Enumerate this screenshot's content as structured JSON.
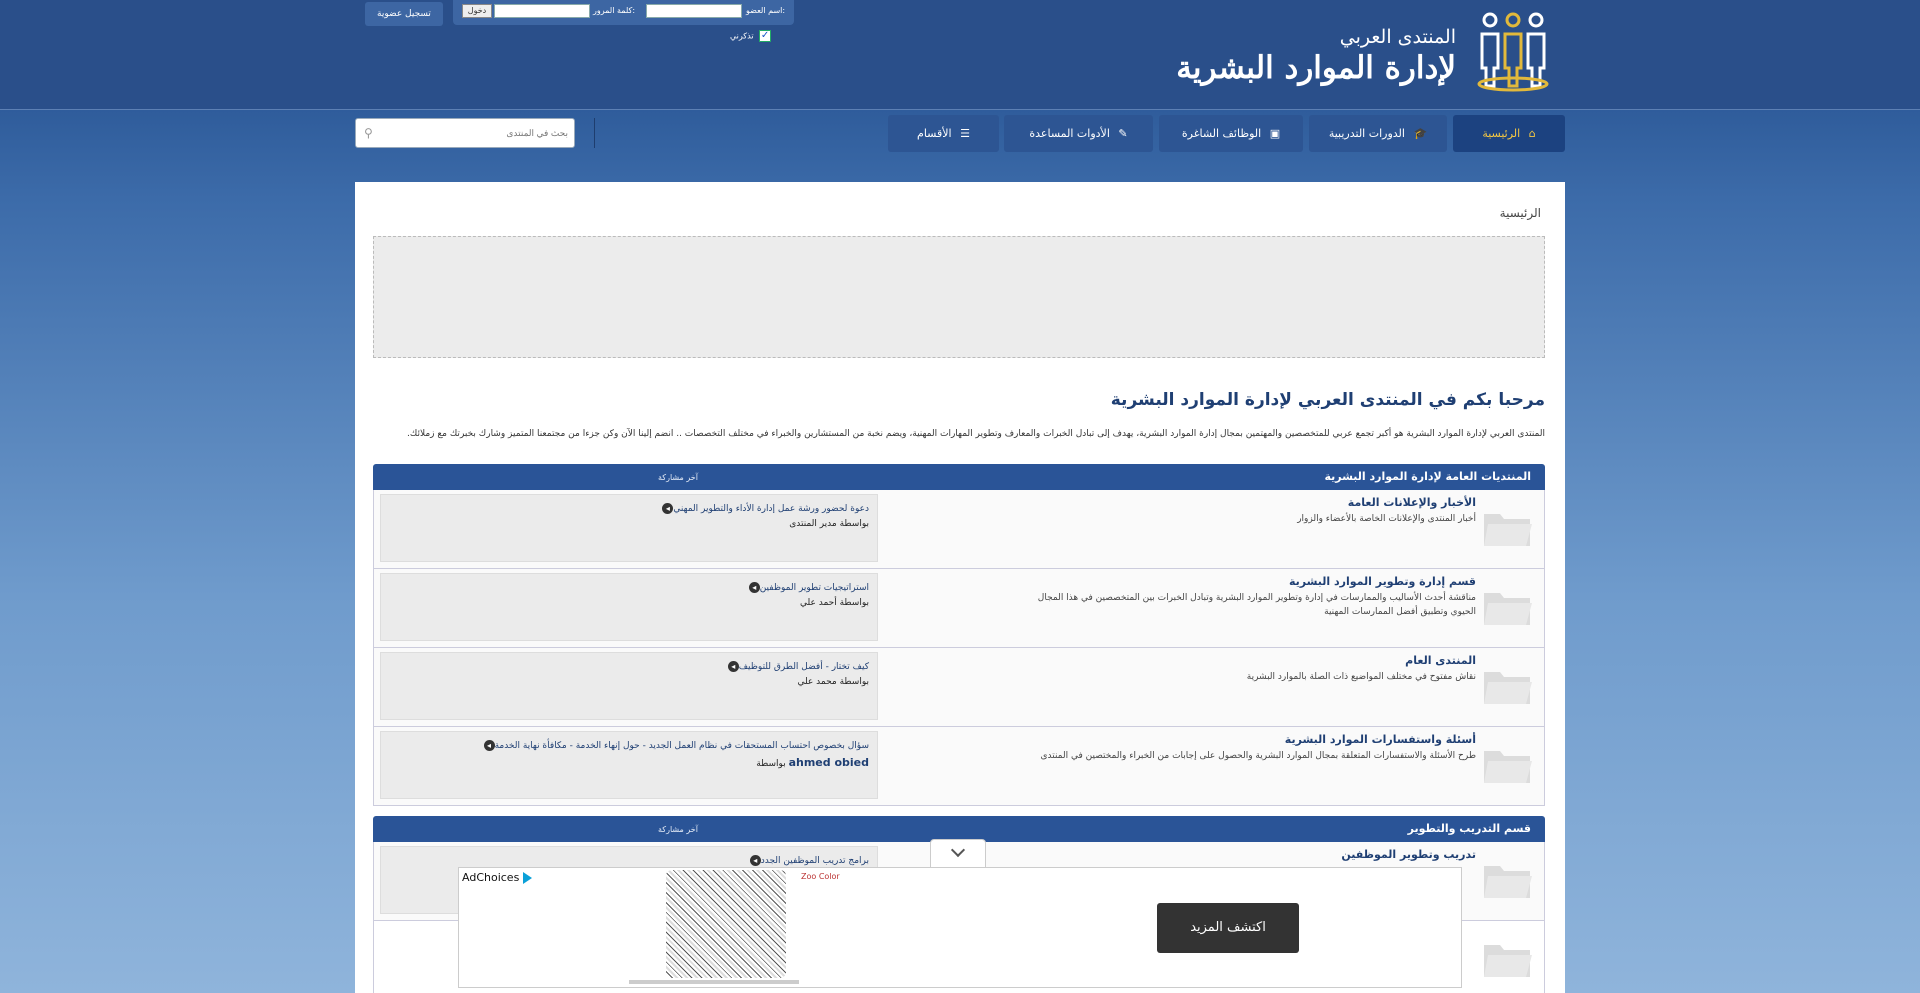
{
  "header": {
    "logo_small": "المنتدى العربي",
    "logo_big": "لإدارة الموارد البشرية",
    "login": {
      "username_label": "اسم العضو:",
      "password_label": "كلمة المرور:",
      "login_button": "دخول",
      "remember": "تذكرني",
      "register_button": "تسجيل عضوية"
    }
  },
  "nav": {
    "items": [
      {
        "label": "الرئيسية",
        "icon": "home-icon"
      },
      {
        "label": "الدورات التدريبية",
        "icon": "graduation-cap-icon"
      },
      {
        "label": "الوظائف الشاغرة",
        "icon": "briefcase-icon"
      },
      {
        "label": "الأدوات المساعدة",
        "icon": "wrench-icon"
      },
      {
        "label": "الأقسام",
        "icon": "list-icon"
      }
    ],
    "search_placeholder": "بحث في المنتدى"
  },
  "breadcrumb": "الرئيسية",
  "welcome": {
    "title": "مرحبا بكم في المنتدى العربي لإدارة الموارد البشرية",
    "text": "المنتدى العربي لإدارة الموارد البشرية هو أكبر تجمع عربي للمتخصصين والمهتمين بمجال إدارة الموارد البشرية، يهدف إلى تبادل الخبرات والمعارف وتطوير المهارات المهنية، ويضم نخبة من المستشارين والخبراء في مختلف التخصصات .. انضم إلينا الآن وكن جزءا من مجتمعنا المتميز وشارك بخبرتك مع زملائك."
  },
  "categories": [
    {
      "title": "المنتديات العامة لإدارة الموارد البشرية",
      "lastpost_header": "آخر مشاركة",
      "forums": [
        {
          "title": "الأخبار والإعلانات العامة",
          "desc": "أخبار المنتدى والإعلانات الخاصة بالأعضاء والزوار",
          "lastpost_title": "دعوة لحضور ورشة عمل إدارة الأداء والتطوير المهني",
          "lastpost_author": "بواسطة مدير المنتدى",
          "author_name": ""
        },
        {
          "title": "قسم إدارة وتطوير الموارد البشرية",
          "desc": "مناقشة أحدث الأساليب والممارسات في إدارة وتطوير الموارد البشرية وتبادل الخبرات بين المتخصصين في هذا المجال الحيوي وتطبيق أفضل الممارسات المهنية",
          "lastpost_title": "استراتيجيات تطوير الموظفين",
          "lastpost_author": "بواسطة أحمد علي",
          "author_name": ""
        },
        {
          "title": "المنتدى العام",
          "desc": "نقاش مفتوح في مختلف المواضيع ذات الصلة بالموارد البشرية",
          "lastpost_title": "كيف تختار - أفضل الطرق للتوظيف",
          "lastpost_author": "بواسطة محمد علي",
          "author_name": ""
        },
        {
          "title": "أسئلة واستفسارات الموارد البشرية",
          "desc": "طرح الأسئلة والاستفسارات المتعلقة بمجال الموارد البشرية والحصول على إجابات من الخبراء والمختصين في المنتدى",
          "lastpost_title": "سؤال بخصوص احتساب المستحقات في نظام العمل الجديد - حول إنهاء الخدمة - مكافأة نهاية الخدمة",
          "lastpost_author": "بواسطة",
          "author_name": "ahmed obied"
        }
      ]
    },
    {
      "title": "قسم التدريب والتطوير",
      "lastpost_header": "آخر مشاركة",
      "forums": [
        {
          "title": "تدريب وتطوير الموظفين",
          "desc": "",
          "lastpost_title": "برامج تدريب الموظفين الجدد",
          "lastpost_author": "",
          "author_name": ""
        },
        {
          "title": "",
          "desc": "",
          "lastpost_title": "",
          "lastpost_author": "",
          "author_name": ""
        }
      ]
    }
  ],
  "ad": {
    "adchoices": "AdChoices",
    "brand": "Zoo Color",
    "cta": "اكتشف المزيد"
  },
  "colors": {
    "header_bg": "#2a4f8a",
    "nav_active_text": "#f5c842",
    "category_header": "#2a5497"
  }
}
